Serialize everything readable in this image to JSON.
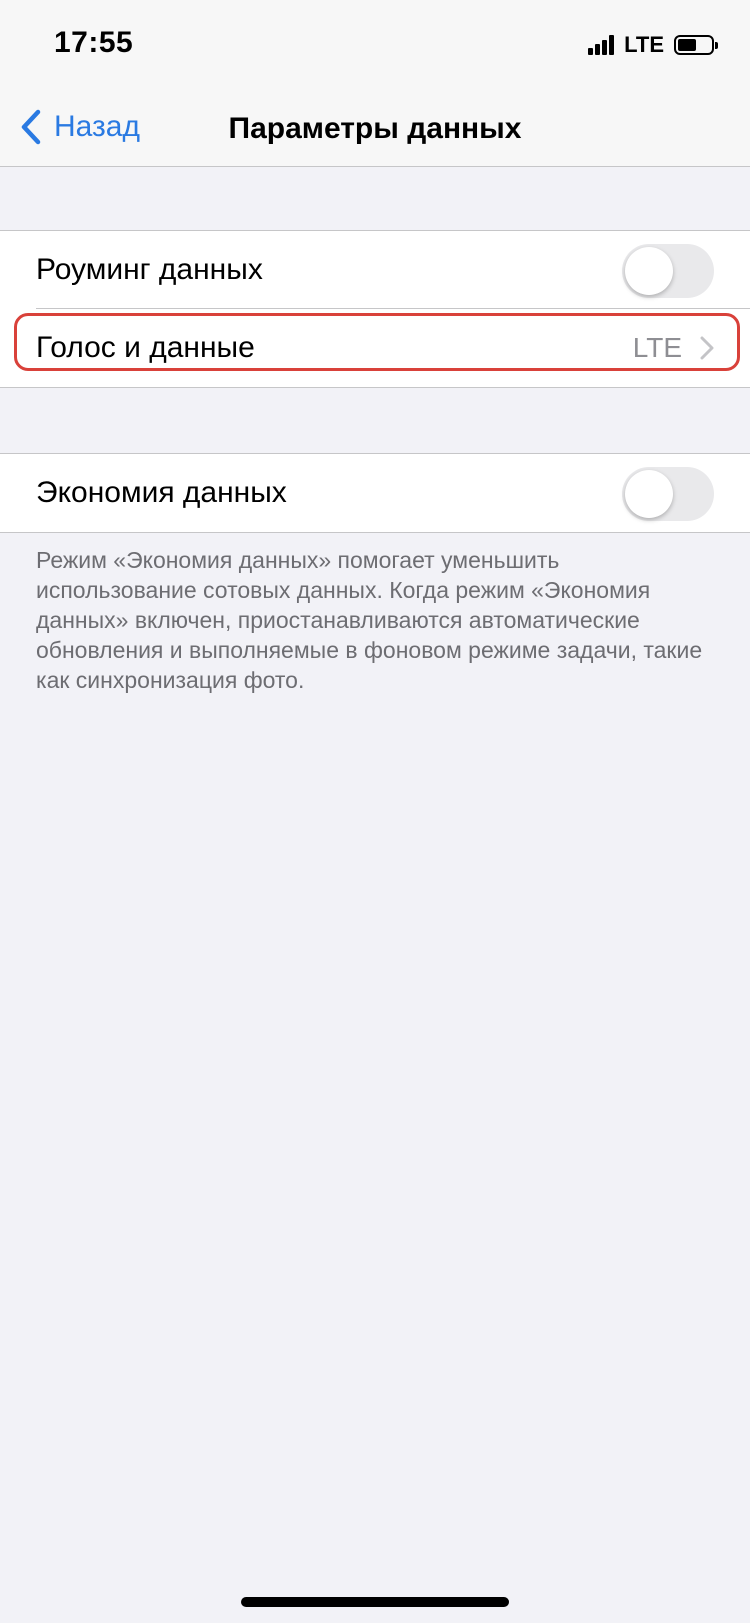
{
  "status_bar": {
    "time": "17:55",
    "network": "LTE",
    "battery_level": 0.55
  },
  "nav": {
    "back_label": "Назад",
    "title": "Параметры данных"
  },
  "settings": {
    "roaming": {
      "label": "Роуминг данных",
      "enabled": false
    },
    "voice_data": {
      "label": "Голос и данные",
      "value": "LTE"
    },
    "low_data": {
      "label": "Экономия данных",
      "enabled": false,
      "footer": "Режим «Экономия данных» помогает уменьшить использование сотовых данных. Когда режим «Экономия данных» включен, приостанавливаются автоматические обновления и выполняемые в фоновом режиме задачи, такие как синхронизация фото."
    }
  },
  "colors": {
    "accent": "#2a7ae2",
    "highlight": "#d9413a",
    "background": "#f2f2f7"
  },
  "icons": {
    "back": "chevron-left-icon",
    "disclosure": "chevron-right-icon",
    "signal": "cellular-signal-icon",
    "battery": "battery-icon"
  }
}
